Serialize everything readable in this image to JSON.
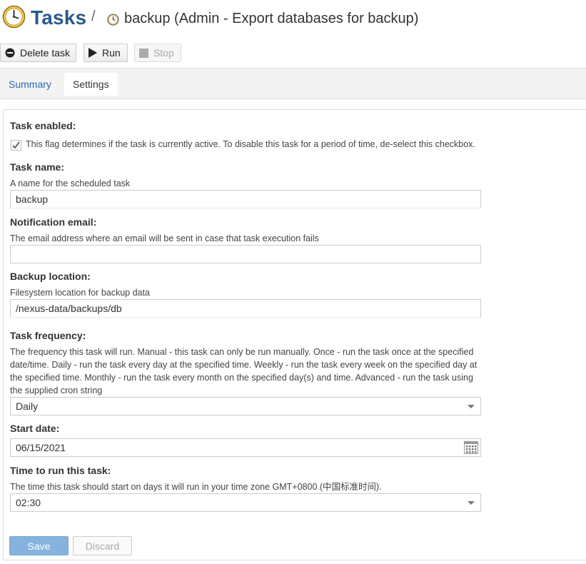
{
  "header": {
    "section_title": "Tasks",
    "separator": "/",
    "task_title": "backup (Admin - Export databases for backup)"
  },
  "toolbar": {
    "delete_label": "Delete task",
    "run_label": "Run",
    "stop_label": "Stop"
  },
  "tabs": [
    {
      "label": "Summary",
      "active": false
    },
    {
      "label": "Settings",
      "active": true
    }
  ],
  "form": {
    "task_enabled": {
      "label": "Task enabled:",
      "checked": true,
      "help": "This flag determines if the task is currently active. To disable this task for a period of time, de-select this checkbox."
    },
    "task_name": {
      "label": "Task name:",
      "help": "A name for the scheduled task",
      "value": "backup"
    },
    "notification_email": {
      "label": "Notification email:",
      "help": "The email address where an email will be sent in case that task execution fails",
      "value": ""
    },
    "backup_location": {
      "label": "Backup location:",
      "help": "Filesystem location for backup data",
      "value": "/nexus-data/backups/db"
    },
    "task_frequency": {
      "label": "Task frequency:",
      "help": "The frequency this task will run. Manual - this task can only be run manually. Once - run the task once at the specified date/time. Daily - run the task every day at the specified time. Weekly - run the task every week on the specified day at the specified time. Monthly - run the task every month on the specified day(s) and time. Advanced - run the task using the supplied cron string",
      "value": "Daily"
    },
    "start_date": {
      "label": "Start date:",
      "value": "06/15/2021"
    },
    "time_to_run": {
      "label": "Time to run this task:",
      "help": "The time this task should start on days it will run in your time zone GMT+0800 (中国标准时间).",
      "value": "02:30"
    }
  },
  "buttons": {
    "save_label": "Save",
    "discard_label": "Discard"
  },
  "colors": {
    "title_blue": "#2a5a8a",
    "link_blue": "#2a6ab0",
    "save_bg": "#86b3dd"
  }
}
